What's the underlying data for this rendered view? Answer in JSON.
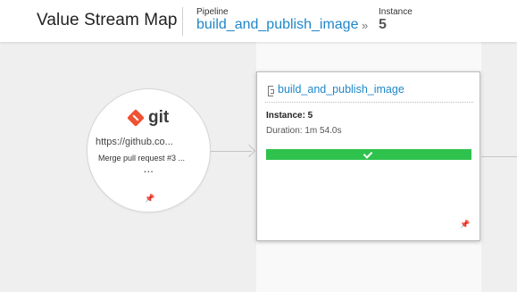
{
  "header": {
    "title": "Value Stream Map",
    "pipeline_label": "Pipeline",
    "pipeline_name": "build_and_publish_image",
    "separator": "»",
    "instance_label": "Instance",
    "instance_value": "5"
  },
  "material": {
    "logo_text": "git",
    "url": "https://github.co...",
    "commit_message": "Merge pull request #3 ...",
    "more": "...",
    "pin_icon": "pin-icon",
    "logo_color": "#f05133"
  },
  "pipeline_card": {
    "name": "build_and_publish_image",
    "instance": "Instance: 5",
    "duration": "Duration: 1m 54.0s",
    "stage_status": "passed",
    "stage_color": "#2fc24c",
    "pin_icon": "pin-icon"
  },
  "colors": {
    "link": "#1f87c9",
    "background": "#efefef"
  }
}
